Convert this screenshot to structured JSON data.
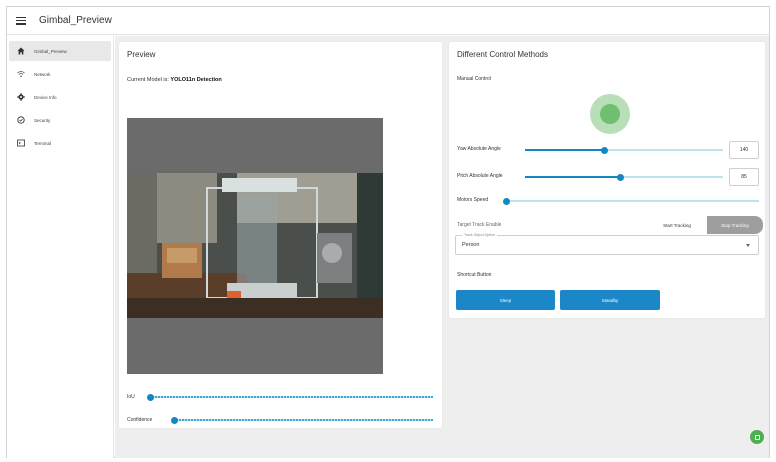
{
  "app": {
    "title": "Gimbal_Preview"
  },
  "sidebar": {
    "items": [
      {
        "label": "Gimbal_Preview",
        "icon": "home-icon",
        "active": true
      },
      {
        "label": "Network",
        "icon": "wifi-icon",
        "active": false
      },
      {
        "label": "Device Info",
        "icon": "gear-icon",
        "active": false
      },
      {
        "label": "Security",
        "icon": "shield-icon",
        "active": false
      },
      {
        "label": "Terminal",
        "icon": "terminal-icon",
        "active": false
      }
    ]
  },
  "preview": {
    "title": "Preview",
    "model_prefix": "Current Model is:",
    "model_name": "YOLO11n Detection",
    "iou_label": "IoU",
    "iou_value": 0.0,
    "confidence_label": "Confidence",
    "confidence_value": 0.04
  },
  "controls": {
    "title": "Different Control Methods",
    "manual_control_label": "Manual Control",
    "yaw_label": "Yaw Absolute Angle",
    "yaw_value": "140",
    "pitch_label": "Pitch Absolute Angle",
    "pitch_value": "85",
    "motors_speed_label": "Motors Speed",
    "target_track_label": "Target Track Enable",
    "start_tracking_label": "Start Tracking",
    "stop_tracking_label": "Stop Tracking",
    "track_object_legend": "Track Object Option",
    "track_object_value": "Person",
    "shortcut_label": "Shortcut Button",
    "sleep_label": "Sleep",
    "standby_label": "Standby"
  },
  "colors": {
    "accent": "#1287c2",
    "button_blue": "#1b87c9",
    "joystick": "#6fbf70",
    "fab": "#4caf50"
  }
}
